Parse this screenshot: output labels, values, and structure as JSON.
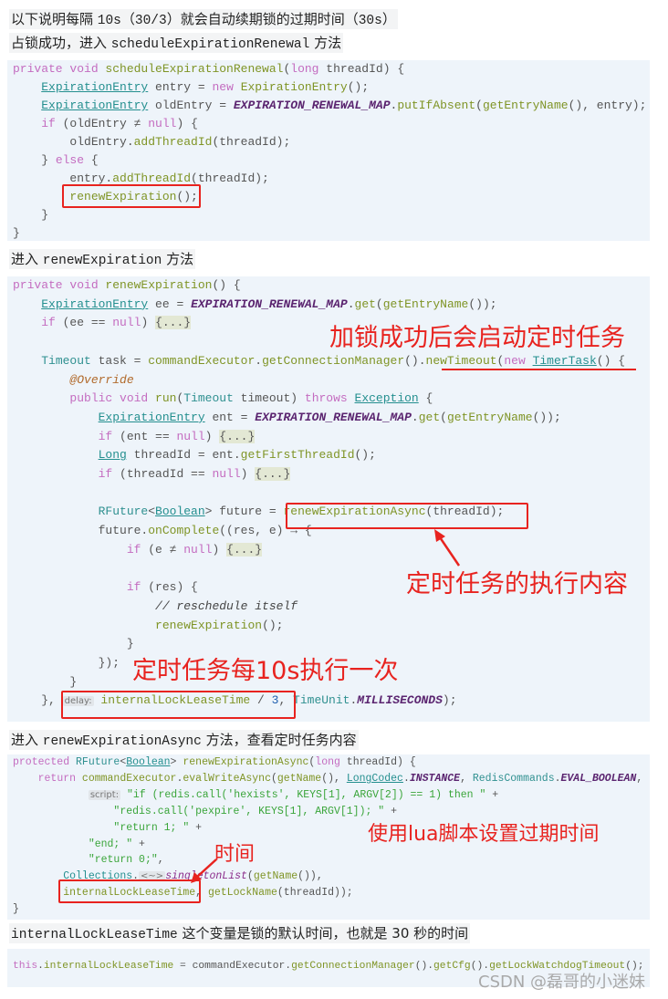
{
  "headings": {
    "h1": [
      {
        "t": "以下说明每隔 "
      },
      {
        "t": "10s",
        "mono": true
      },
      {
        "t": "（"
      },
      {
        "t": "30/3",
        "mono": true
      },
      {
        "t": "）就会自动续期锁的过期时间（"
      },
      {
        "t": "30s",
        "mono": true
      },
      {
        "t": "）"
      }
    ],
    "h2": [
      {
        "t": "占锁成功，进入 "
      },
      {
        "t": "scheduleExpirationRenewal",
        "mono": true
      },
      {
        "t": " 方法"
      }
    ],
    "h3": [
      {
        "t": "进入 "
      },
      {
        "t": "renewExpiration",
        "mono": true
      },
      {
        "t": " 方法"
      }
    ],
    "h4": [
      {
        "t": "进入 "
      },
      {
        "t": "renewExpirationAsync",
        "mono": true
      },
      {
        "t": " 方法，查看定时任务内容"
      }
    ],
    "h5": [
      {
        "t": "internalLockLeaseTime",
        "mono": true
      },
      {
        "t": " 这个变量是锁的默认时间，也就是 30 秒的时间"
      }
    ]
  },
  "code_blocks": [
    [
      [
        [
          "kw",
          "private void "
        ],
        [
          "fn",
          "scheduleExpirationRenewal"
        ],
        [
          "pl",
          "("
        ],
        [
          "kw",
          "long"
        ],
        [
          "pl",
          " threadId) {"
        ]
      ],
      [
        [
          "pl",
          "    "
        ],
        [
          "ty",
          "ExpirationEntry"
        ],
        [
          "pl",
          " entry = "
        ],
        [
          "kw",
          "new"
        ],
        [
          "pl",
          " "
        ],
        [
          "fn",
          "ExpirationEntry"
        ],
        [
          "pl",
          "();"
        ]
      ],
      [
        [
          "pl",
          "    "
        ],
        [
          "ty",
          "ExpirationEntry"
        ],
        [
          "pl",
          " oldEntry = "
        ],
        [
          "cn",
          "EXPIRATION_RENEWAL_MAP"
        ],
        [
          "pl",
          "."
        ],
        [
          "fn",
          "putIfAbsent"
        ],
        [
          "pl",
          "("
        ],
        [
          "fn",
          "getEntryName"
        ],
        [
          "pl",
          "(), entry);"
        ]
      ],
      [
        [
          "pl",
          "    "
        ],
        [
          "kw",
          "if"
        ],
        [
          "pl",
          " (oldEntry ≠ "
        ],
        [
          "kw",
          "null"
        ],
        [
          "pl",
          ") {"
        ]
      ],
      [
        [
          "pl",
          "        oldEntry."
        ],
        [
          "fn",
          "addThreadId"
        ],
        [
          "pl",
          "(threadId);"
        ]
      ],
      [
        [
          "pl",
          "    } "
        ],
        [
          "kw",
          "else"
        ],
        [
          "pl",
          " {"
        ]
      ],
      [
        [
          "pl",
          "        entry."
        ],
        [
          "fn",
          "addThreadId"
        ],
        [
          "pl",
          "(threadId);"
        ]
      ],
      [
        [
          "pl",
          "        "
        ],
        [
          "fn",
          "renewExpiration"
        ],
        [
          "pl",
          "();"
        ]
      ],
      [
        [
          "pl",
          "    }"
        ]
      ],
      [
        [
          "pl",
          "}"
        ]
      ]
    ],
    [
      [
        [
          "kw",
          "private void "
        ],
        [
          "fn",
          "renewExpiration"
        ],
        [
          "pl",
          "() {"
        ]
      ],
      [
        [
          "pl",
          "    "
        ],
        [
          "ty",
          "ExpirationEntry"
        ],
        [
          "pl",
          " ee = "
        ],
        [
          "cn",
          "EXPIRATION_RENEWAL_MAP"
        ],
        [
          "pl",
          "."
        ],
        [
          "fn",
          "get"
        ],
        [
          "pl",
          "("
        ],
        [
          "fn",
          "getEntryName"
        ],
        [
          "pl",
          "());"
        ]
      ],
      [
        [
          "pl",
          "    "
        ],
        [
          "kw",
          "if"
        ],
        [
          "pl",
          " (ee == "
        ],
        [
          "kw",
          "null"
        ],
        [
          "pl",
          ") "
        ],
        [
          "fold",
          "{...}"
        ]
      ],
      [
        [
          "pl",
          " "
        ]
      ],
      [
        [
          "pl",
          "    "
        ],
        [
          "tyx",
          "Timeout"
        ],
        [
          "pl",
          " task = "
        ],
        [
          "fn",
          "commandExecutor"
        ],
        [
          "pl",
          "."
        ],
        [
          "fn",
          "getConnectionManager"
        ],
        [
          "pl",
          "()."
        ],
        [
          "fn",
          "newTimeout"
        ],
        [
          "pl",
          "("
        ],
        [
          "kw",
          "new"
        ],
        [
          "pl",
          " "
        ],
        [
          "ty",
          "TimerTask"
        ],
        [
          "pl",
          "() {"
        ]
      ],
      [
        [
          "pl",
          "        "
        ],
        [
          "ann",
          "@Override"
        ]
      ],
      [
        [
          "pl",
          "        "
        ],
        [
          "kw",
          "public void "
        ],
        [
          "fn",
          "run"
        ],
        [
          "pl",
          "("
        ],
        [
          "tyx",
          "Timeout"
        ],
        [
          "pl",
          " timeout) "
        ],
        [
          "kw",
          "throws"
        ],
        [
          "pl",
          " "
        ],
        [
          "ty",
          "Exception"
        ],
        [
          "pl",
          " {"
        ]
      ],
      [
        [
          "pl",
          "            "
        ],
        [
          "ty",
          "ExpirationEntry"
        ],
        [
          "pl",
          " ent = "
        ],
        [
          "cn",
          "EXPIRATION_RENEWAL_MAP"
        ],
        [
          "pl",
          "."
        ],
        [
          "fn",
          "get"
        ],
        [
          "pl",
          "("
        ],
        [
          "fn",
          "getEntryName"
        ],
        [
          "pl",
          "());"
        ]
      ],
      [
        [
          "pl",
          "            "
        ],
        [
          "kw",
          "if"
        ],
        [
          "pl",
          " (ent == "
        ],
        [
          "kw",
          "null"
        ],
        [
          "pl",
          ") "
        ],
        [
          "fold",
          "{...}"
        ]
      ],
      [
        [
          "pl",
          "            "
        ],
        [
          "ty",
          "Long"
        ],
        [
          "pl",
          " threadId = ent."
        ],
        [
          "fn",
          "getFirstThreadId"
        ],
        [
          "pl",
          "();"
        ]
      ],
      [
        [
          "pl",
          "            "
        ],
        [
          "kw",
          "if"
        ],
        [
          "pl",
          " (threadId == "
        ],
        [
          "kw",
          "null"
        ],
        [
          "pl",
          ") "
        ],
        [
          "fold",
          "{...}"
        ]
      ],
      [
        [
          "pl",
          " "
        ]
      ],
      [
        [
          "pl",
          "            "
        ],
        [
          "tyx",
          "RFuture"
        ],
        [
          "pl",
          "<"
        ],
        [
          "ty",
          "Boolean"
        ],
        [
          "pl",
          "> future = "
        ],
        [
          "fn",
          "renewExpirationAsync"
        ],
        [
          "pl",
          "(threadId);"
        ]
      ],
      [
        [
          "pl",
          "            future."
        ],
        [
          "fn",
          "onComplete"
        ],
        [
          "pl",
          "((res, e) → {"
        ]
      ],
      [
        [
          "pl",
          "                "
        ],
        [
          "kw",
          "if"
        ],
        [
          "pl",
          " (e ≠ "
        ],
        [
          "kw",
          "null"
        ],
        [
          "pl",
          ") "
        ],
        [
          "fold",
          "{...}"
        ]
      ],
      [
        [
          "pl",
          " "
        ]
      ],
      [
        [
          "pl",
          "                "
        ],
        [
          "kw",
          "if"
        ],
        [
          "pl",
          " (res) {"
        ]
      ],
      [
        [
          "pl",
          "                    "
        ],
        [
          "cm",
          "// reschedule itself"
        ]
      ],
      [
        [
          "pl",
          "                    "
        ],
        [
          "fn",
          "renewExpiration"
        ],
        [
          "pl",
          "();"
        ]
      ],
      [
        [
          "pl",
          "                }"
        ]
      ],
      [
        [
          "pl",
          "            });"
        ]
      ],
      [
        [
          "pl",
          "        }"
        ]
      ],
      [
        [
          "pl",
          "    }, "
        ],
        [
          "hint",
          "delay:"
        ],
        [
          "pl",
          " "
        ],
        [
          "fn",
          "internalLockLeaseTime"
        ],
        [
          "pl",
          " / "
        ],
        [
          "num",
          "3"
        ],
        [
          "pl",
          ", "
        ],
        [
          "tyx",
          "TimeUnit"
        ],
        [
          "pl",
          "."
        ],
        [
          "cn",
          "MILLISECONDS"
        ],
        [
          "pl",
          ");"
        ]
      ]
    ],
    [
      [
        [
          "kw",
          "protected "
        ],
        [
          "tyx",
          "RFuture"
        ],
        [
          "pl",
          "<"
        ],
        [
          "ty",
          "Boolean"
        ],
        [
          "pl",
          "> "
        ],
        [
          "fn",
          "renewExpirationAsync"
        ],
        [
          "pl",
          "("
        ],
        [
          "kw",
          "long"
        ],
        [
          "pl",
          " threadId) {"
        ]
      ],
      [
        [
          "pl",
          "    "
        ],
        [
          "kw",
          "return "
        ],
        [
          "fn",
          "commandExecutor"
        ],
        [
          "pl",
          "."
        ],
        [
          "fn",
          "evalWriteAsync"
        ],
        [
          "pl",
          "("
        ],
        [
          "fn",
          "getName"
        ],
        [
          "pl",
          "(), "
        ],
        [
          "ty",
          "LongCodec"
        ],
        [
          "pl",
          "."
        ],
        [
          "cn",
          "INSTANCE"
        ],
        [
          "pl",
          ", "
        ],
        [
          "tyx",
          "RedisCommands"
        ],
        [
          "pl",
          "."
        ],
        [
          "cn",
          "EVAL_BOOLEAN"
        ],
        [
          "pl",
          ","
        ]
      ],
      [
        [
          "pl",
          "            "
        ],
        [
          "hint",
          "script:"
        ],
        [
          "pl",
          " "
        ],
        [
          "str",
          "\"if (redis.call('hexists', KEYS[1], ARGV[2]) == 1) then \""
        ],
        [
          "pl",
          " +"
        ]
      ],
      [
        [
          "pl",
          "                "
        ],
        [
          "str",
          "\"redis.call('pexpire', KEYS[1], ARGV[1]); \""
        ],
        [
          "pl",
          " +"
        ]
      ],
      [
        [
          "pl",
          "                "
        ],
        [
          "str",
          "\"return 1; \""
        ],
        [
          "pl",
          " +"
        ]
      ],
      [
        [
          "pl",
          "            "
        ],
        [
          "str",
          "\"end; \""
        ],
        [
          "pl",
          " +"
        ]
      ],
      [
        [
          "pl",
          "            "
        ],
        [
          "str",
          "\"return 0;\""
        ],
        [
          "pl",
          ","
        ]
      ],
      [
        [
          "pl",
          "        "
        ],
        [
          "ty",
          "Collections"
        ],
        [
          "pl",
          "."
        ],
        [
          "hint",
          "<~>"
        ],
        [
          "st",
          "singletonList"
        ],
        [
          "pl",
          "("
        ],
        [
          "fn",
          "getName"
        ],
        [
          "pl",
          "()),"
        ]
      ],
      [
        [
          "pl",
          "        "
        ],
        [
          "fn",
          "internalLockLeaseTime"
        ],
        [
          "pl",
          ", "
        ],
        [
          "fn",
          "getLockName"
        ],
        [
          "pl",
          "(threadId));"
        ]
      ],
      [
        [
          "pl",
          "}"
        ]
      ]
    ],
    [
      [
        [
          "kw",
          "this"
        ],
        [
          "pl",
          "."
        ],
        [
          "fn",
          "internalLockLeaseTime"
        ],
        [
          "pl",
          " = commandExecutor."
        ],
        [
          "fn",
          "getConnectionManager"
        ],
        [
          "pl",
          "()."
        ],
        [
          "fn",
          "getCfg"
        ],
        [
          "pl",
          "()."
        ],
        [
          "fn",
          "getLockWatchdogTimeout"
        ],
        [
          "pl",
          "();"
        ]
      ]
    ]
  ],
  "annotations": {
    "lock_success": "加锁成功后会启动定时任务",
    "task_content": "定时任务的执行内容",
    "every_10s": "定时任务每10s执行一次",
    "lua_script": "使用lua脚本设置过期时间",
    "time": "时间"
  },
  "watermark": "CSDN @磊哥的小迷妹",
  "colors": {
    "annotation_red": "#e8231f",
    "code_bg": "#eef4fa"
  }
}
